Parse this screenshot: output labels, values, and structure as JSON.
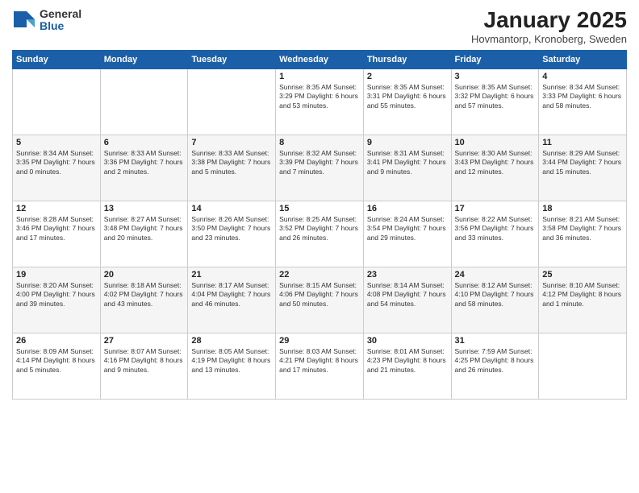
{
  "logo": {
    "general": "General",
    "blue": "Blue"
  },
  "title": "January 2025",
  "location": "Hovmantorp, Kronoberg, Sweden",
  "weekdays": [
    "Sunday",
    "Monday",
    "Tuesday",
    "Wednesday",
    "Thursday",
    "Friday",
    "Saturday"
  ],
  "weeks": [
    [
      {
        "day": "",
        "info": ""
      },
      {
        "day": "",
        "info": ""
      },
      {
        "day": "",
        "info": ""
      },
      {
        "day": "1",
        "info": "Sunrise: 8:35 AM\nSunset: 3:29 PM\nDaylight: 6 hours\nand 53 minutes."
      },
      {
        "day": "2",
        "info": "Sunrise: 8:35 AM\nSunset: 3:31 PM\nDaylight: 6 hours\nand 55 minutes."
      },
      {
        "day": "3",
        "info": "Sunrise: 8:35 AM\nSunset: 3:32 PM\nDaylight: 6 hours\nand 57 minutes."
      },
      {
        "day": "4",
        "info": "Sunrise: 8:34 AM\nSunset: 3:33 PM\nDaylight: 6 hours\nand 58 minutes."
      }
    ],
    [
      {
        "day": "5",
        "info": "Sunrise: 8:34 AM\nSunset: 3:35 PM\nDaylight: 7 hours\nand 0 minutes."
      },
      {
        "day": "6",
        "info": "Sunrise: 8:33 AM\nSunset: 3:36 PM\nDaylight: 7 hours\nand 2 minutes."
      },
      {
        "day": "7",
        "info": "Sunrise: 8:33 AM\nSunset: 3:38 PM\nDaylight: 7 hours\nand 5 minutes."
      },
      {
        "day": "8",
        "info": "Sunrise: 8:32 AM\nSunset: 3:39 PM\nDaylight: 7 hours\nand 7 minutes."
      },
      {
        "day": "9",
        "info": "Sunrise: 8:31 AM\nSunset: 3:41 PM\nDaylight: 7 hours\nand 9 minutes."
      },
      {
        "day": "10",
        "info": "Sunrise: 8:30 AM\nSunset: 3:43 PM\nDaylight: 7 hours\nand 12 minutes."
      },
      {
        "day": "11",
        "info": "Sunrise: 8:29 AM\nSunset: 3:44 PM\nDaylight: 7 hours\nand 15 minutes."
      }
    ],
    [
      {
        "day": "12",
        "info": "Sunrise: 8:28 AM\nSunset: 3:46 PM\nDaylight: 7 hours\nand 17 minutes."
      },
      {
        "day": "13",
        "info": "Sunrise: 8:27 AM\nSunset: 3:48 PM\nDaylight: 7 hours\nand 20 minutes."
      },
      {
        "day": "14",
        "info": "Sunrise: 8:26 AM\nSunset: 3:50 PM\nDaylight: 7 hours\nand 23 minutes."
      },
      {
        "day": "15",
        "info": "Sunrise: 8:25 AM\nSunset: 3:52 PM\nDaylight: 7 hours\nand 26 minutes."
      },
      {
        "day": "16",
        "info": "Sunrise: 8:24 AM\nSunset: 3:54 PM\nDaylight: 7 hours\nand 29 minutes."
      },
      {
        "day": "17",
        "info": "Sunrise: 8:22 AM\nSunset: 3:56 PM\nDaylight: 7 hours\nand 33 minutes."
      },
      {
        "day": "18",
        "info": "Sunrise: 8:21 AM\nSunset: 3:58 PM\nDaylight: 7 hours\nand 36 minutes."
      }
    ],
    [
      {
        "day": "19",
        "info": "Sunrise: 8:20 AM\nSunset: 4:00 PM\nDaylight: 7 hours\nand 39 minutes."
      },
      {
        "day": "20",
        "info": "Sunrise: 8:18 AM\nSunset: 4:02 PM\nDaylight: 7 hours\nand 43 minutes."
      },
      {
        "day": "21",
        "info": "Sunrise: 8:17 AM\nSunset: 4:04 PM\nDaylight: 7 hours\nand 46 minutes."
      },
      {
        "day": "22",
        "info": "Sunrise: 8:15 AM\nSunset: 4:06 PM\nDaylight: 7 hours\nand 50 minutes."
      },
      {
        "day": "23",
        "info": "Sunrise: 8:14 AM\nSunset: 4:08 PM\nDaylight: 7 hours\nand 54 minutes."
      },
      {
        "day": "24",
        "info": "Sunrise: 8:12 AM\nSunset: 4:10 PM\nDaylight: 7 hours\nand 58 minutes."
      },
      {
        "day": "25",
        "info": "Sunrise: 8:10 AM\nSunset: 4:12 PM\nDaylight: 8 hours\nand 1 minute."
      }
    ],
    [
      {
        "day": "26",
        "info": "Sunrise: 8:09 AM\nSunset: 4:14 PM\nDaylight: 8 hours\nand 5 minutes."
      },
      {
        "day": "27",
        "info": "Sunrise: 8:07 AM\nSunset: 4:16 PM\nDaylight: 8 hours\nand 9 minutes."
      },
      {
        "day": "28",
        "info": "Sunrise: 8:05 AM\nSunset: 4:19 PM\nDaylight: 8 hours\nand 13 minutes."
      },
      {
        "day": "29",
        "info": "Sunrise: 8:03 AM\nSunset: 4:21 PM\nDaylight: 8 hours\nand 17 minutes."
      },
      {
        "day": "30",
        "info": "Sunrise: 8:01 AM\nSunset: 4:23 PM\nDaylight: 8 hours\nand 21 minutes."
      },
      {
        "day": "31",
        "info": "Sunrise: 7:59 AM\nSunset: 4:25 PM\nDaylight: 8 hours\nand 26 minutes."
      },
      {
        "day": "",
        "info": ""
      }
    ]
  ]
}
